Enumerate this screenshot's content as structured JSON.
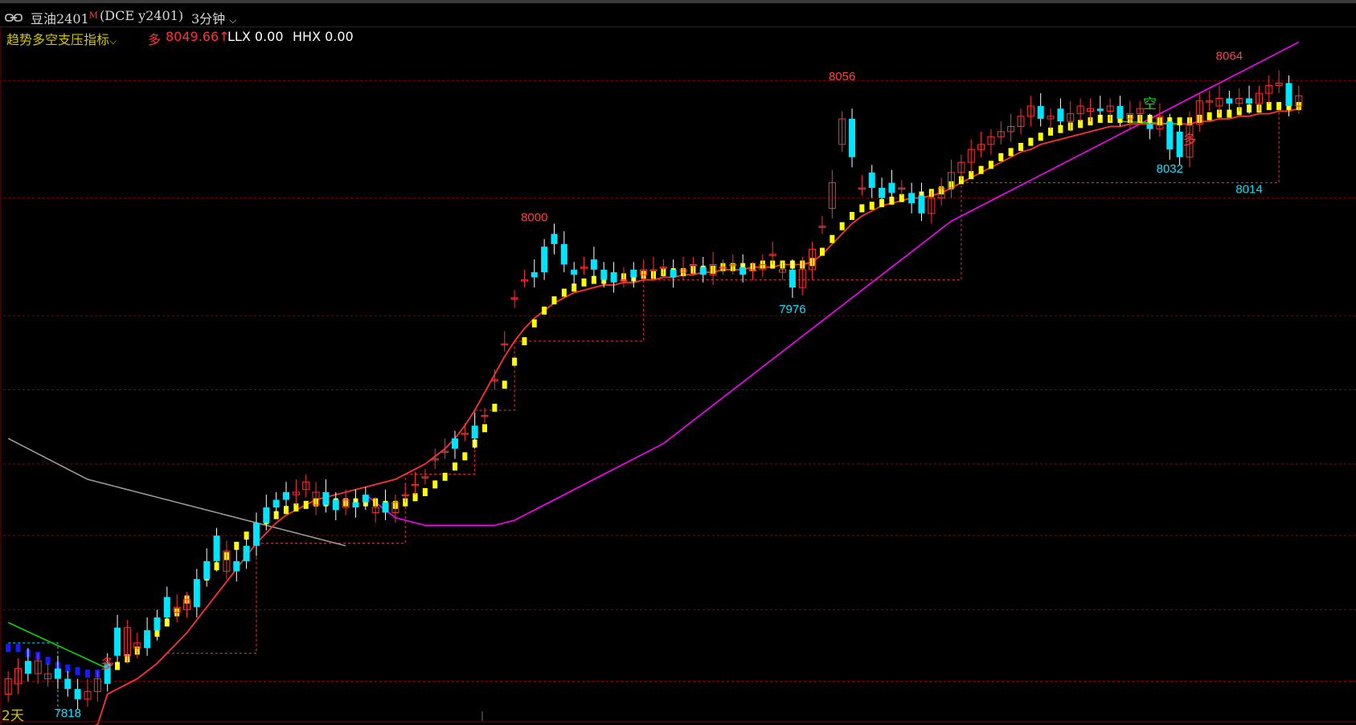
{
  "header": {
    "symbol": "豆油2401",
    "sup": "M",
    "exchange": "(DCE y2401)",
    "period": "3分钟",
    "dropdown_glyph": "⌵"
  },
  "indicator": {
    "name": "趋势多空支压指标",
    "name_dropdown": "⌵",
    "signal_label": "多",
    "signal_value": "8049.66↑",
    "llx": "LLX 0.00",
    "hhx": "HHX 0.00"
  },
  "footer": {
    "days": "2天"
  },
  "colors": {
    "bg": "#000000",
    "up": "#ff3232",
    "down": "#00e5ff",
    "yellow": "#ffff00",
    "magenta": "#ff00ff",
    "gray": "#a0a0a0",
    "green": "#00e600",
    "blue": "#1a1aff",
    "grid": "#8a0000",
    "title_indicator": "#d4c400",
    "label_red": "#ff4040",
    "label_cyan": "#00e5ff"
  },
  "chart_data": {
    "type": "candlestick",
    "ylim": [
      7812,
      8072
    ],
    "x_count": 131,
    "grid_prices": [
      8060,
      8014,
      7968,
      7939,
      7910,
      7882,
      7853,
      7825
    ],
    "annotations": [
      {
        "text": "8064",
        "x": 123,
        "y": 8068,
        "color": "label_red"
      },
      {
        "text": "8056",
        "x": 84,
        "y": 8060,
        "color": "label_red"
      },
      {
        "text": "8000",
        "x": 53,
        "y": 8005,
        "color": "label_red"
      },
      {
        "text": "8032",
        "x": 117,
        "y": 8024,
        "color": "label_cyan"
      },
      {
        "text": "8014",
        "x": 125,
        "y": 8016,
        "color": "label_cyan"
      },
      {
        "text": "7976",
        "x": 79,
        "y": 7969,
        "color": "label_cyan"
      },
      {
        "text": "7818",
        "x": 6,
        "y": 7811,
        "color": "label_cyan"
      }
    ],
    "signals": [
      {
        "text": "空",
        "x": 115,
        "y": 8049,
        "color": "green"
      },
      {
        "text": "多",
        "x": 119,
        "y": 8035,
        "color": "up"
      },
      {
        "text": "多",
        "x": 10,
        "y": 7830,
        "color": "up"
      }
    ],
    "candles_close": [
      7826,
      7830,
      7828,
      7833,
      7828,
      7826,
      7822,
      7818,
      7821,
      7826,
      7824,
      7835,
      7846,
      7840,
      7838,
      7845,
      7850,
      7854,
      7857,
      7854,
      7865,
      7872,
      7876,
      7868,
      7872,
      7878,
      7887,
      7893,
      7896,
      7899,
      7903,
      7899,
      7894,
      7892,
      7896,
      7893,
      7895,
      7893,
      7891,
      7895,
      7898,
      7902,
      7905,
      7912,
      7915,
      7916,
      7922,
      7920,
      7929,
      7943,
      7957,
      7975,
      7982,
      7983,
      7985,
      7996,
      7988,
      7984,
      7987,
      7986,
      7982,
      7981,
      7982,
      7983,
      7986,
      7986,
      7987,
      7983,
      7986,
      7988,
      7984,
      7988,
      7987,
      7988,
      7984,
      7986,
      7988,
      7992,
      7986,
      7979,
      7986,
      7994,
      8003,
      8020,
      8045,
      8030,
      8018,
      8018,
      8014,
      8016,
      8018,
      8012,
      8008,
      8014,
      8018,
      8024,
      8028,
      8033,
      8035,
      8038,
      8040,
      8042,
      8046,
      8050,
      8045,
      8046,
      8044,
      8047,
      8050,
      8049,
      8048,
      8050,
      8045,
      8047,
      8049,
      8041,
      8046,
      8033,
      8030,
      8043,
      8052,
      8052,
      8053,
      8051,
      8053,
      8051,
      8055,
      8058,
      8059,
      8050,
      8054
    ],
    "candles_open": [
      7820,
      7824,
      7833,
      7828,
      7826,
      7830,
      7826,
      7822,
      7818,
      7821,
      7832,
      7846,
      7835,
      7838,
      7845,
      7850,
      7858,
      7852,
      7853,
      7865,
      7872,
      7882,
      7868,
      7872,
      7878,
      7887,
      7893,
      7896,
      7899,
      7898,
      7900,
      7894,
      7899,
      7896,
      7893,
      7895,
      7898,
      7891,
      7895,
      7891,
      7898,
      7902,
      7905,
      7912,
      7915,
      7920,
      7922,
      7925,
      7929,
      7943,
      7957,
      7975,
      7982,
      7985,
      7995,
      8000,
      7996,
      7986,
      7987,
      7990,
      7986,
      7985,
      7982,
      7986,
      7984,
      7986,
      7987,
      7986,
      7985,
      7988,
      7987,
      7984,
      7987,
      7988,
      7987,
      7986,
      7986,
      7992,
      7985,
      7986,
      7979,
      7986,
      8003,
      8010,
      8035,
      8045,
      8018,
      8024,
      8018,
      8020,
      8018,
      8016,
      8015,
      8008,
      8014,
      8018,
      8024,
      8028,
      8033,
      8035,
      8038,
      8040,
      8042,
      8046,
      8050,
      8045,
      8049,
      8044,
      8047,
      8048,
      8049,
      8048,
      8050,
      8045,
      8047,
      8043,
      8041,
      8044,
      8040,
      8030,
      8043,
      8052,
      8050,
      8053,
      8051,
      8053,
      8051,
      8055,
      8058,
      8059,
      8050
    ],
    "yellow_dash": [
      7838,
      7838,
      7836,
      7835,
      7833,
      7831,
      7830,
      7829,
      7828,
      7828,
      7829,
      7831,
      7834,
      7837,
      7840,
      7844,
      7848,
      7852,
      7857,
      7861,
      7866,
      7870,
      7874,
      7878,
      7882,
      7885,
      7888,
      7890,
      7892,
      7893,
      7894,
      7895,
      7895,
      7895,
      7895,
      7895,
      7895,
      7895,
      7894,
      7894,
      7895,
      7897,
      7899,
      7902,
      7905,
      7909,
      7913,
      7918,
      7924,
      7932,
      7941,
      7950,
      7958,
      7965,
      7970,
      7974,
      7977,
      7979,
      7981,
      7982,
      7982,
      7983,
      7983,
      7983,
      7984,
      7984,
      7985,
      7985,
      7985,
      7986,
      7986,
      7986,
      7987,
      7987,
      7987,
      7987,
      7988,
      7988,
      7988,
      7988,
      7988,
      7989,
      7993,
      7998,
      8003,
      8007,
      8010,
      8011,
      8012,
      8013,
      8014,
      8014,
      8015,
      8016,
      8017,
      8019,
      8021,
      8023,
      8025,
      8027,
      8030,
      8032,
      8034,
      8036,
      8038,
      8040,
      8041,
      8042,
      8043,
      8044,
      8045,
      8045,
      8045,
      8045,
      8045,
      8045,
      8044,
      8044,
      8044,
      8044,
      8045,
      8046,
      8047,
      8047,
      8048,
      8049,
      8049,
      8050,
      8050,
      8050,
      8050
    ],
    "red_ma": [
      7800,
      7800,
      7801,
      7802,
      7803,
      7804,
      7805,
      7806,
      7807,
      7808,
      7820,
      7822,
      7824,
      7826,
      7829,
      7832,
      7836,
      7840,
      7844,
      7849,
      7854,
      7859,
      7864,
      7869,
      7874,
      7879,
      7883,
      7887,
      7890,
      7892,
      7894,
      7896,
      7897,
      7898,
      7899,
      7900,
      7901,
      7902,
      7903,
      7904,
      7906,
      7908,
      7910,
      7913,
      7916,
      7920,
      7925,
      7931,
      7938,
      7945,
      7952,
      7958,
      7963,
      7967,
      7970,
      7973,
      7975,
      7977,
      7978,
      7979,
      7980,
      7980,
      7981,
      7981,
      7982,
      7982,
      7983,
      7983,
      7984,
      7984,
      7985,
      7985,
      7986,
      7986,
      7986,
      7987,
      7987,
      7987,
      7988,
      7988,
      7988,
      7989,
      7992,
      7996,
      8000,
      8004,
      8007,
      8009,
      8011,
      8012,
      8013,
      8014,
      8014,
      8015,
      8016,
      8018,
      8020,
      8022,
      8024,
      8026,
      8028,
      8030,
      8032,
      8033,
      8035,
      8036,
      8037,
      8038,
      8039,
      8040,
      8041,
      8042,
      8042,
      8043,
      8043,
      8043,
      8043,
      8043,
      8043,
      8043,
      8044,
      8044,
      8045,
      8045,
      8046,
      8046,
      8047,
      8047,
      8048,
      8048,
      8049
    ],
    "magenta_ma": [
      7800,
      7800,
      7800,
      7800,
      7800,
      7800,
      7800,
      7800,
      7800,
      7800,
      7800,
      7800,
      7800,
      7800,
      7800,
      7800,
      7800,
      7800,
      7800,
      7800,
      7800,
      7800,
      7800,
      7800,
      7800,
      7800,
      7800,
      7800,
      7800,
      7800,
      7800,
      7800,
      7800,
      7800,
      7800,
      7800,
      7898,
      7895,
      7892,
      7889,
      7888,
      7887,
      7886,
      7886,
      7886,
      7886,
      7886,
      7886,
      7886,
      7886,
      7887,
      7888,
      7890,
      7892,
      7894,
      7896,
      7898,
      7900,
      7902,
      7904,
      7906,
      7908,
      7910,
      7912,
      7914,
      7916,
      7918,
      7921,
      7924,
      7927,
      7930,
      7933,
      7936,
      7939,
      7942,
      7945,
      7948,
      7951,
      7954,
      7957,
      7960,
      7963,
      7966,
      7969,
      7972,
      7975,
      7978,
      7981,
      7984,
      7987,
      7990,
      7993,
      7996,
      7999,
      8002,
      8005,
      8007,
      8009,
      8011,
      8013,
      8015,
      8017,
      8019,
      8021,
      8023,
      8025,
      8027,
      8029,
      8031,
      8033,
      8035,
      8037,
      8039,
      8041,
      8043,
      8045,
      8047,
      8049,
      8051,
      8053,
      8055,
      8057,
      8059,
      8061,
      8063,
      8065,
      8067,
      8069,
      8071,
      8073,
      8075
    ],
    "gray_ma": [
      7920,
      7918,
      7916,
      7914,
      7912,
      7910,
      7908,
      7906,
      7904,
      7903,
      7902,
      7901,
      7900,
      7899,
      7898,
      7897,
      7896,
      7895,
      7894,
      7893,
      7892,
      7891,
      7890,
      7889,
      7888,
      7887,
      7886,
      7885,
      7884,
      7883,
      7882,
      7881,
      7880,
      7879,
      7878
    ]
  }
}
